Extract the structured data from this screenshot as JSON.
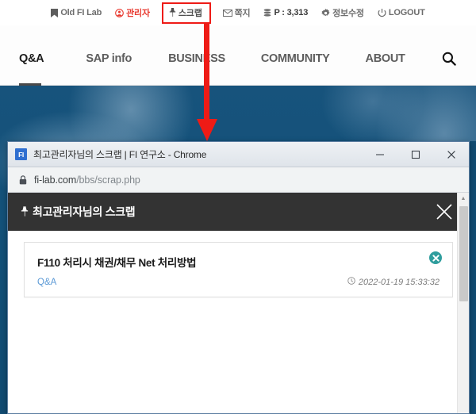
{
  "site": {
    "utility_menu": [
      {
        "id": "old-fi-lab",
        "icon": "bookmark-icon",
        "label": "Old FI Lab",
        "highlight": false,
        "style": "default"
      },
      {
        "id": "admin",
        "icon": "user-circle-icon",
        "label": "관리자",
        "highlight": false,
        "style": "danger"
      },
      {
        "id": "scrap",
        "icon": "pin-icon",
        "label": "스크랩",
        "highlight": true,
        "style": "default"
      },
      {
        "id": "note",
        "icon": "envelope-icon",
        "label": "쪽지",
        "highlight": false,
        "style": "default"
      },
      {
        "id": "points",
        "icon": "coins-icon",
        "label": "P : 3,313",
        "highlight": false,
        "style": "default"
      },
      {
        "id": "edit-info",
        "icon": "gear-icon",
        "label": "정보수정",
        "highlight": false,
        "style": "default"
      },
      {
        "id": "logout",
        "icon": "power-icon",
        "label": "LOGOUT",
        "highlight": false,
        "style": "default"
      }
    ],
    "main_nav": [
      {
        "id": "qa",
        "label": "Q&A",
        "active": true
      },
      {
        "id": "sap-info",
        "label": "SAP info",
        "active": false
      },
      {
        "id": "business",
        "label": "BUSINESS",
        "active": false
      },
      {
        "id": "community",
        "label": "COMMUNITY",
        "active": false
      },
      {
        "id": "about",
        "label": "ABOUT",
        "active": false
      }
    ],
    "search_icon": "search-icon"
  },
  "annotation": {
    "type": "arrow",
    "color": "#ee1b16",
    "points_from": "스크랩",
    "points_to": "browser-window"
  },
  "browser": {
    "favicon_text": "FI",
    "window_title": "최고관리자님의 스크랩 | FI 연구소 - Chrome",
    "controls": {
      "minimize": "minimize-icon",
      "maximize": "maximize-icon",
      "close": "close-icon"
    },
    "address": {
      "lock_icon": "lock-icon",
      "domain": "fi-lab.com",
      "path": "/bbs/scrap.php",
      "full": "fi-lab.com/bbs/scrap.php"
    }
  },
  "page": {
    "header": {
      "pin_icon": "pin-icon",
      "title": "최고관리자님의 스크랩",
      "close_icon": "close-icon",
      "background": "#333333"
    },
    "scrap_items": [
      {
        "title": "F110 처리시 채권/채무 Net 처리방법",
        "category": "Q&A",
        "clock_icon": "clock-icon",
        "datetime": "2022-01-19 15:33:32",
        "delete_icon": "delete-circle-icon",
        "delete_color": "#2f9d9d"
      }
    ]
  }
}
